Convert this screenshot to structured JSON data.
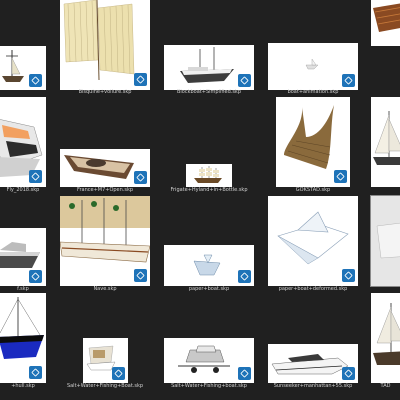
{
  "files": [
    {
      "name": "",
      "icon": "sketchup-file-icon"
    },
    {
      "name": "Bisquine+voilure.skp",
      "icon": "sketchup-file-icon"
    },
    {
      "name": "Blockboat+Simplified.skp",
      "icon": "sketchup-file-icon"
    },
    {
      "name": "boat+animation.skp",
      "icon": "sketchup-file-icon"
    },
    {
      "name": "",
      "icon": "sketchup-file-icon"
    },
    {
      "name": "Fly_2018.skp",
      "icon": "sketchup-file-icon"
    },
    {
      "name": "France+M7+Open.skp",
      "icon": "sketchup-file-icon"
    },
    {
      "name": "Frigate+Hyland+in+Bottle.skp",
      "icon": "sketchup-file-icon"
    },
    {
      "name": "GOKSTAD.skp",
      "icon": "sketchup-file-icon"
    },
    {
      "name": "",
      "icon": "sketchup-file-icon"
    },
    {
      "name": "f.skp",
      "icon": "sketchup-file-icon"
    },
    {
      "name": "Nave.skp",
      "icon": "sketchup-file-icon"
    },
    {
      "name": "paper+boat.skp",
      "icon": "sketchup-file-icon"
    },
    {
      "name": "paper+boat+deformed.skp",
      "icon": "sketchup-file-icon"
    },
    {
      "name": "",
      "icon": "sketchup-file-icon"
    },
    {
      "name": "+hull.skp",
      "icon": "sketchup-file-icon"
    },
    {
      "name": "Salt+Water+Fishing+Boat.skp",
      "icon": "sketchup-file-icon"
    },
    {
      "name": "Salt+Water+Fishing+boat.skp",
      "icon": "sketchup-file-icon"
    },
    {
      "name": "Sunseeker+manhattan+55.skp",
      "icon": "sketchup-file-icon"
    },
    {
      "name": "TAD",
      "icon": "sketchup-file-icon"
    }
  ]
}
